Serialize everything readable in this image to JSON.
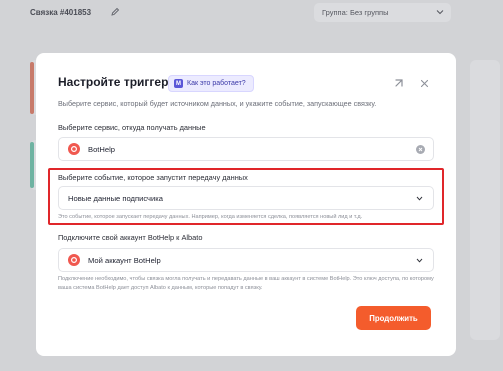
{
  "background": {
    "link_title": "Связка #401853",
    "group_select": "Группа: Без группы"
  },
  "modal": {
    "title": "Настройте триггер",
    "how_button": "Как это работает?",
    "subtitle": "Выберите сервис, который будет источником данных, и укажите событие, запускающее связку.",
    "service": {
      "label": "Выберите сервис, откуда получать данные",
      "value": "BotHelp"
    },
    "event": {
      "label": "Выберите событие, которое запустит передачу данных",
      "value": "Новые данные подписчика",
      "hint": "Это событие, которое запускает передачу данных. Например, когда изменяется сделка, появляется новый лид и т.д."
    },
    "account": {
      "label": "Подключите свой аккаунт BotHelp к Albato",
      "value": "Мой аккаунт BotHelp",
      "hint": "Подключение необходимо, чтобы связка могла получать и передавать данные в ваш аккаунт в системе BotHelp. Это ключ доступа, по которому ваша система BotHelp дает доступ Albato к данным, которые попадут в связку."
    },
    "continue_button": "Продолжить"
  },
  "colors": {
    "accent": "#f45c2c",
    "highlight": "#e0262a",
    "brand_purple": "#5b57d8",
    "bothelp_red": "#f0584f"
  },
  "icons": [
    "pencil-icon",
    "chevron-down-icon",
    "how-it-works-icon",
    "pin-icon",
    "close-icon",
    "bothelp-logo-icon",
    "clear-icon"
  ]
}
